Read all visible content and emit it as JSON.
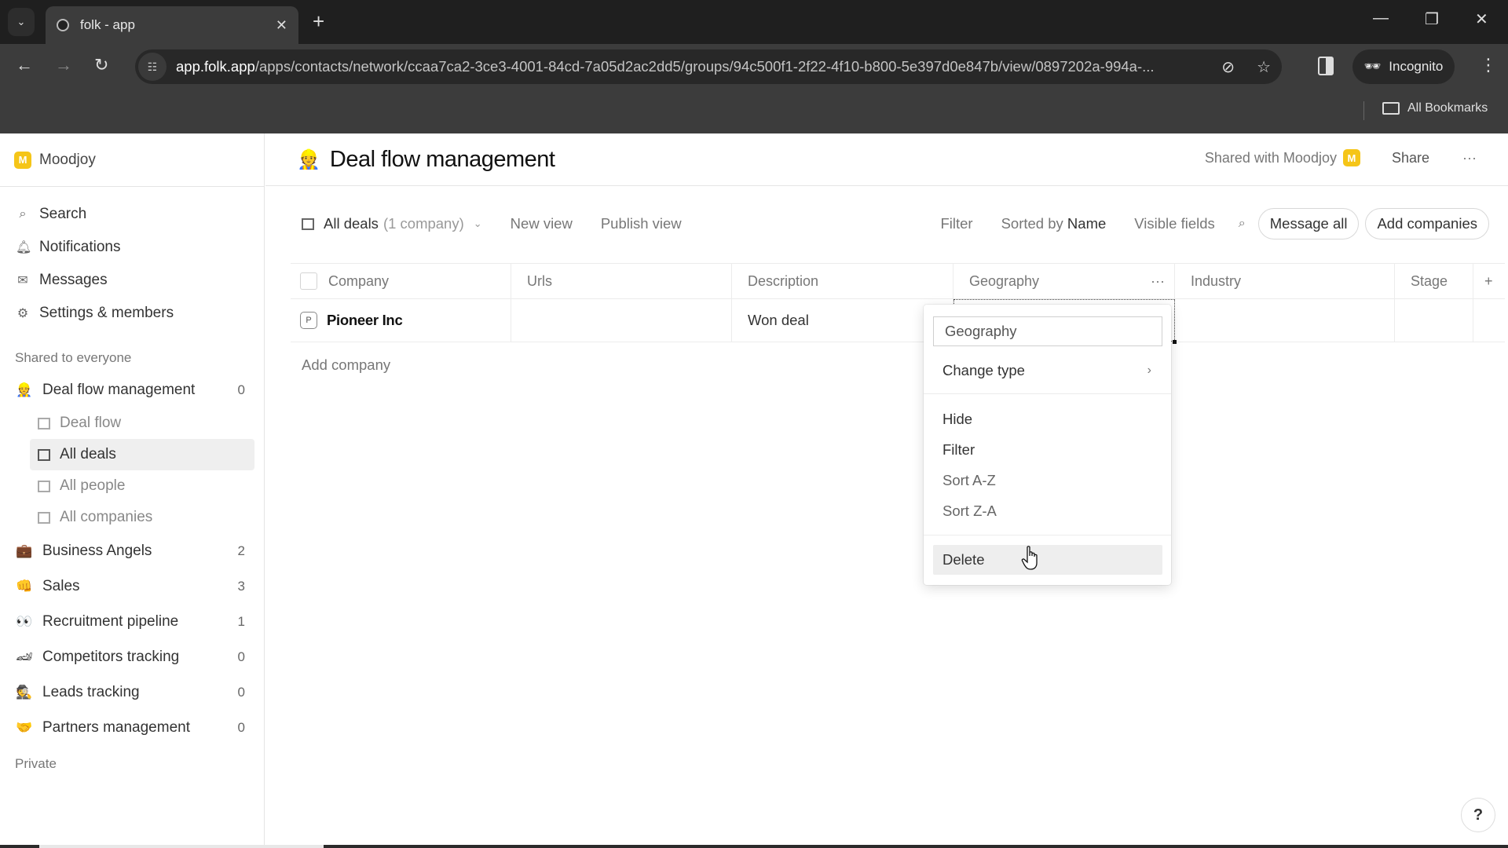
{
  "browser": {
    "tab_title": "folk - app",
    "url_host": "app.folk.app",
    "url_path": "/apps/contacts/network/ccaa7ca2-3ce3-4001-84cd-7a05d2ac2dd5/groups/94c500f1-2f22-4f10-b800-5e397d0e847b/view/0897202a-994a-...",
    "incognito_label": "Incognito",
    "bookmarks_label": "All Bookmarks"
  },
  "sidebar": {
    "workspace_initial": "M",
    "workspace_name": "Moodjoy",
    "nav": [
      {
        "label": "Search",
        "icon": "search-icon"
      },
      {
        "label": "Notifications",
        "icon": "bell-icon"
      },
      {
        "label": "Messages",
        "icon": "mail-icon"
      },
      {
        "label": "Settings & members",
        "icon": "gear-icon"
      }
    ],
    "shared_section_label": "Shared to everyone",
    "groups": [
      {
        "emoji": "👷",
        "name": "Deal flow management",
        "count": "0"
      },
      {
        "emoji": "💼",
        "name": "Business Angels",
        "count": "2"
      },
      {
        "emoji": "👊",
        "name": "Sales",
        "count": "3"
      },
      {
        "emoji": "👀",
        "name": "Recruitment pipeline",
        "count": "1"
      },
      {
        "emoji": "🏎",
        "name": "Competitors tracking",
        "count": "0"
      },
      {
        "emoji": "🕵",
        "name": "Leads tracking",
        "count": "0"
      },
      {
        "emoji": "🤝",
        "name": "Partners management",
        "count": "0"
      }
    ],
    "views": [
      {
        "label": "Deal flow",
        "type": "kanban",
        "active": false
      },
      {
        "label": "All deals",
        "type": "table",
        "active": true
      },
      {
        "label": "All people",
        "type": "table",
        "active": false
      },
      {
        "label": "All companies",
        "type": "table",
        "active": false
      }
    ],
    "private_section_label": "Private"
  },
  "header": {
    "emoji": "👷",
    "title": "Deal flow management",
    "shared_with": "Shared with Moodjoy",
    "shared_avatar": "M",
    "share_label": "Share",
    "more_label": "···"
  },
  "viewbar": {
    "view_name": "All deals",
    "view_count": "(1 company)",
    "new_view": "New view",
    "publish_view": "Publish view",
    "filter": "Filter",
    "sorted_prefix": "Sorted by",
    "sorted_field": "Name",
    "visible_fields": "Visible fields",
    "message_all": "Message all",
    "add_companies": "Add companies"
  },
  "table": {
    "columns": [
      "Company",
      "Urls",
      "Description",
      "Geography",
      "Industry",
      "Stage"
    ],
    "add_column": "+",
    "rows": [
      {
        "badge": "P",
        "company": "Pioneer Inc",
        "urls": "",
        "description": "Won deal",
        "geography": "",
        "industry": "",
        "stage": ""
      }
    ],
    "add_row_label": "Add company"
  },
  "column_menu": {
    "field_name_value": "Geography",
    "change_type": "Change type",
    "hide": "Hide",
    "filter": "Filter",
    "sort_az": "Sort A-Z",
    "sort_za": "Sort Z-A",
    "delete": "Delete"
  },
  "help_label": "?"
}
